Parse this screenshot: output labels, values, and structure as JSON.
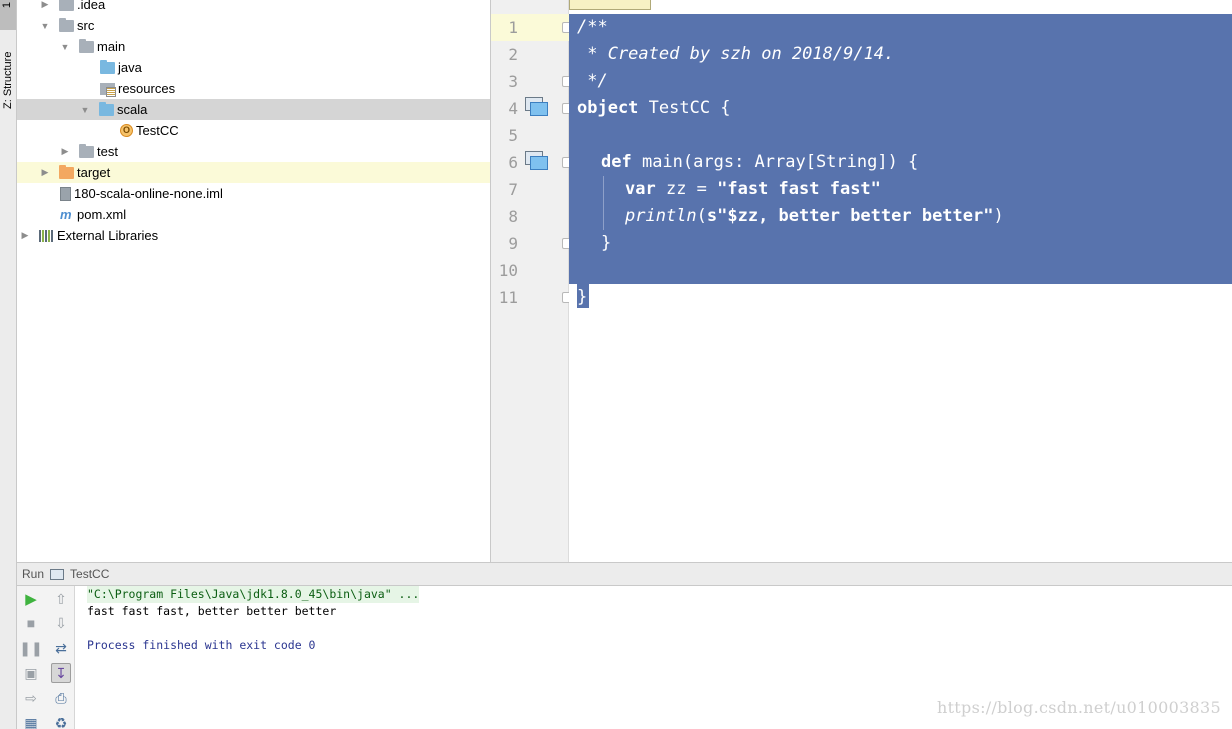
{
  "left_strip": {
    "tab_number": "1",
    "structure_label": "Z: Structure"
  },
  "project_tree": [
    {
      "label": ".idea",
      "icon": "folder-icon"
    },
    {
      "label": "src",
      "icon": "folder-icon"
    },
    {
      "label": "main",
      "icon": "folder-icon"
    },
    {
      "label": "java",
      "icon": "source-folder-icon"
    },
    {
      "label": "resources",
      "icon": "resources-folder-icon"
    },
    {
      "label": "scala",
      "icon": "source-folder-icon"
    },
    {
      "label": "TestCC",
      "icon": "scala-object-icon",
      "badge": "O"
    },
    {
      "label": "test",
      "icon": "folder-icon"
    },
    {
      "label": "target",
      "icon": "excluded-folder-icon"
    },
    {
      "label": "180-scala-online-none.iml",
      "icon": "iml-file-icon"
    },
    {
      "label": "pom.xml",
      "icon": "maven-file-icon",
      "badge": "m"
    },
    {
      "label": "External Libraries",
      "icon": "libraries-icon"
    }
  ],
  "editor": {
    "line_numbers": [
      "1",
      "2",
      "3",
      "4",
      "5",
      "6",
      "7",
      "8",
      "9",
      "10",
      "11"
    ],
    "lines": {
      "l1": "/**",
      "l2": " * Created by szh on 2018/9/14.",
      "l3": " */",
      "l4_kw": "object",
      "l4_rest": " TestCC {",
      "l6_kw": "def",
      "l6_rest": " main(args: Array[String]) {",
      "l7_kw": "var",
      "l7_mid": " zz = ",
      "l7_str": "\"fast fast fast\"",
      "l8_fn": "println",
      "l8_paren": "(",
      "l8_str": "s\"$zz, better better better\"",
      "l8_close": ")",
      "l9": "}",
      "l11": "}"
    },
    "selection_color": "#5873ad"
  },
  "run_panel": {
    "header_label": "Run",
    "config_name": "TestCC",
    "console": {
      "command": "\"C:\\Program Files\\Java\\jdk1.8.0_45\\bin\\java\" ...",
      "output": "fast fast fast, better better better",
      "exit": "Process finished with exit code 0"
    }
  },
  "watermark": "https://blog.csdn.net/u010003835"
}
